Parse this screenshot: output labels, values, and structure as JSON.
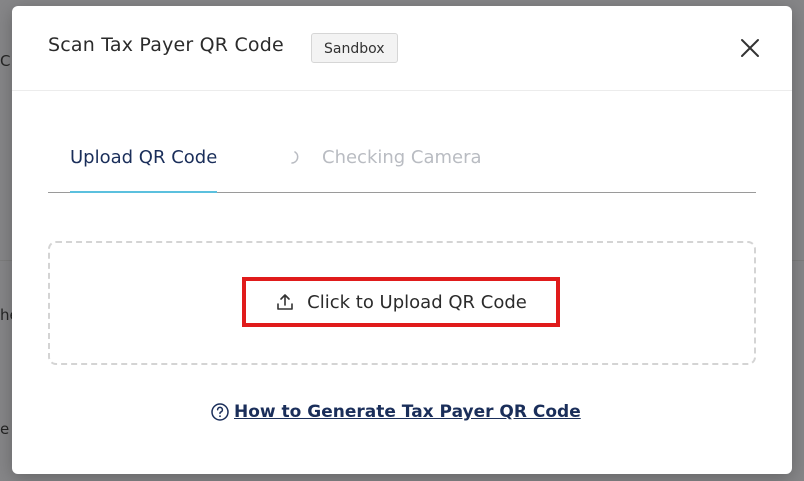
{
  "background": {
    "fragments": [
      "C",
      "he",
      "e 2"
    ]
  },
  "modal": {
    "title": "Scan Tax Payer QR Code",
    "badge": "Sandbox",
    "close_icon": "close-icon"
  },
  "tabs": [
    {
      "label": "Upload QR Code",
      "active": true
    },
    {
      "label": "Checking Camera",
      "active": false,
      "icon": "spinner-icon"
    }
  ],
  "dropzone": {
    "button_label": "Click to Upload QR Code",
    "button_icon": "upload-icon"
  },
  "help": {
    "link_label": "How to Generate Tax Payer QR Code",
    "icon": "question-circle-icon"
  },
  "colors": {
    "accent_ink": "#5bc0de",
    "link": "#1a2e5a",
    "highlight": "#e01b1b"
  }
}
